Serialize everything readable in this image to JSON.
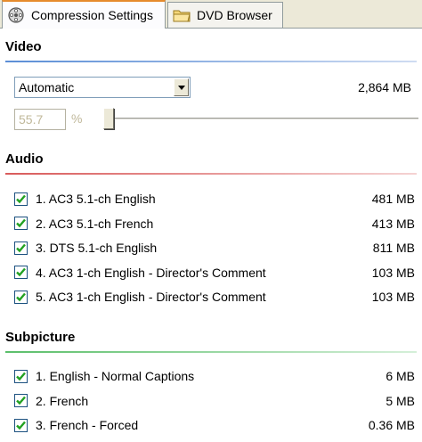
{
  "tabs": [
    {
      "label": "Compression Settings",
      "icon": "film-reel-icon",
      "active": true
    },
    {
      "label": "DVD Browser",
      "icon": "folder-icon",
      "active": false
    }
  ],
  "video": {
    "title": "Video",
    "mode": "Automatic",
    "size": "2,864 MB",
    "quality": "55.7",
    "quality_unit": "%",
    "slider_level_percent": 0
  },
  "audio": {
    "title": "Audio",
    "tracks": [
      {
        "label": "1. AC3 5.1-ch English",
        "size": "481 MB",
        "checked": true
      },
      {
        "label": "2. AC3 5.1-ch French",
        "size": "413 MB",
        "checked": true
      },
      {
        "label": "3. DTS 5.1-ch English",
        "size": "811 MB",
        "checked": true
      },
      {
        "label": "4. AC3 1-ch English - Director's Comment",
        "size": "103 MB",
        "checked": true
      },
      {
        "label": "5. AC3 1-ch English - Director's Comment",
        "size": "103 MB",
        "checked": true
      }
    ]
  },
  "subpicture": {
    "title": "Subpicture",
    "tracks": [
      {
        "label": "1. English - Normal Captions",
        "size": "6 MB",
        "checked": true
      },
      {
        "label": "2. French",
        "size": "5 MB",
        "checked": true
      },
      {
        "label": "3. French - Forced",
        "size": "0.36 MB",
        "checked": true
      }
    ]
  },
  "colors": {
    "video_rule": "#5b8ed6",
    "audio_rule": "#d95b5b",
    "subpicture_rule": "#5bbf6a",
    "check_color": "#21a121",
    "tab_highlight": "#e68b2c"
  }
}
